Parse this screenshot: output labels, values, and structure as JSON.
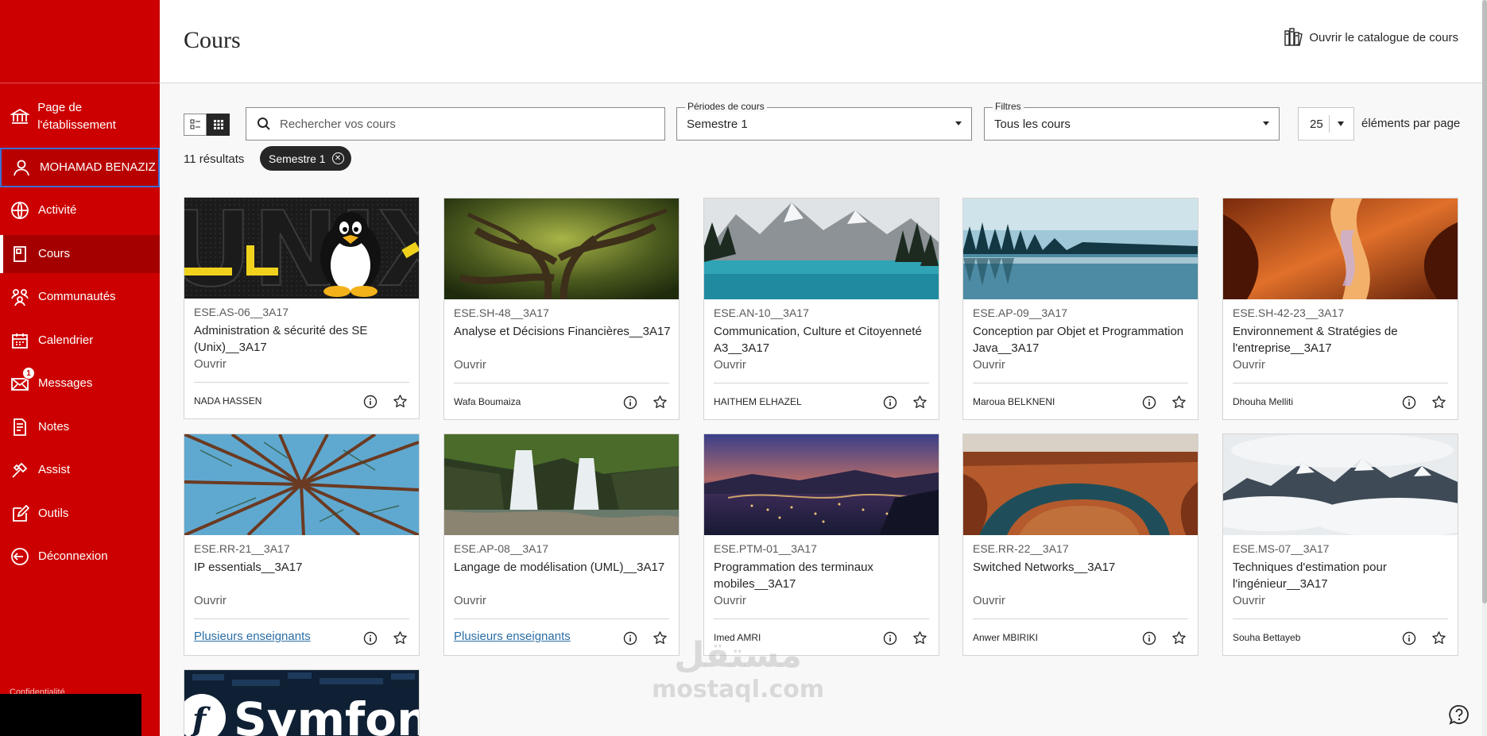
{
  "sidebar": {
    "items": [
      {
        "name": "institution",
        "label": "Page de l'établissement"
      },
      {
        "name": "profile",
        "label": "MOHAMAD BENAZIZ"
      },
      {
        "name": "activity",
        "label": "Activité"
      },
      {
        "name": "courses",
        "label": "Cours"
      },
      {
        "name": "communities",
        "label": "Communautés"
      },
      {
        "name": "calendar",
        "label": "Calendrier"
      },
      {
        "name": "messages",
        "label": "Messages",
        "badge": "1"
      },
      {
        "name": "grades",
        "label": "Notes"
      },
      {
        "name": "assist",
        "label": "Assist"
      },
      {
        "name": "tools",
        "label": "Outils"
      },
      {
        "name": "logout",
        "label": "Déconnexion"
      }
    ],
    "footer_text": "Confidentialité"
  },
  "header": {
    "title": "Cours",
    "catalog_link": "Ouvrir le catalogue de cours"
  },
  "toolbar": {
    "search_placeholder": "Rechercher vos cours",
    "periods_label": "Périodes de cours",
    "periods_value": "Semestre 1",
    "filters_label": "Filtres",
    "filters_value": "Tous les cours",
    "page_size": "25",
    "page_size_label": "éléments par page",
    "results": "11 résultats",
    "chip": "Semestre 1"
  },
  "courses": [
    {
      "code": "ESE.AS-06__3A17",
      "title": "Administration & sécurité des SE (Unix)__3A17",
      "status": "Ouvrir",
      "teacher": "NADA HASSEN",
      "multi": false
    },
    {
      "code": "ESE.SH-48__3A17",
      "title": "Analyse et Décisions Financières__3A17",
      "status": "Ouvrir",
      "teacher": "Wafa Boumaiza",
      "multi": false
    },
    {
      "code": "ESE.AN-10__3A17",
      "title": "Communication, Culture et Citoyenneté A3__3A17",
      "status": "Ouvrir",
      "teacher": "HAITHEM ELHAZEL",
      "multi": false
    },
    {
      "code": "ESE.AP-09__3A17",
      "title": "Conception par Objet et Programmation Java__3A17",
      "status": "Ouvrir",
      "teacher": "Maroua BELKNENI",
      "multi": false
    },
    {
      "code": "ESE.SH-42-23__3A17",
      "title": "Environnement & Stratégies de l'entreprise__3A17",
      "status": "Ouvrir",
      "teacher": "Dhouha Melliti",
      "multi": false
    },
    {
      "code": "ESE.RR-21__3A17",
      "title": "IP essentials__3A17",
      "status": "Ouvrir",
      "teacher": "Plusieurs enseignants",
      "multi": true
    },
    {
      "code": "ESE.AP-08__3A17",
      "title": "Langage de modélisation (UML)__3A17",
      "status": "Ouvrir",
      "teacher": "Plusieurs enseignants",
      "multi": true
    },
    {
      "code": "ESE.PTM-01__3A17",
      "title": "Programmation des terminaux mobiles__3A17",
      "status": "Ouvrir",
      "teacher": "Imed AMRI",
      "multi": false
    },
    {
      "code": "ESE.RR-22__3A17",
      "title": "Switched Networks__3A17",
      "status": "Ouvrir",
      "teacher": "Anwer MBIRIKI",
      "multi": false
    },
    {
      "code": "ESE.MS-07__3A17",
      "title": "Techniques d'estimation pour l'ingénieur__3A17",
      "status": "Ouvrir",
      "teacher": "Souha Bettayeb",
      "multi": false
    }
  ],
  "partial_card": {
    "image_text": "Symfon"
  },
  "unix_image_text": "UNIX",
  "watermark": {
    "arabic": "مستقل",
    "latin": "mostaql.com"
  },
  "colors": {
    "brand": "#cc0000",
    "active": "#a50000",
    "link": "#2a6ea6"
  }
}
